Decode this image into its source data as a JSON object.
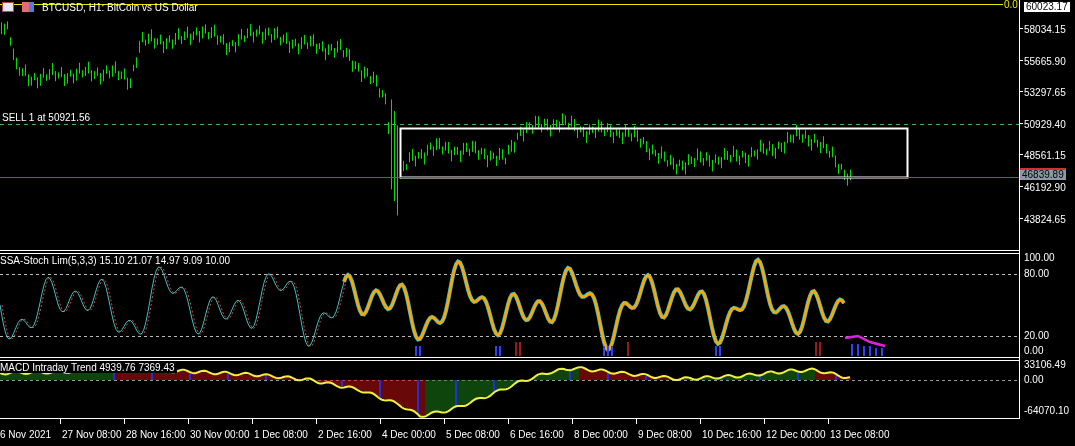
{
  "window": {
    "title": "BTCUSD, H1:  BitCoin vs US Dollar"
  },
  "main_pane": {
    "fibo_label": "0.0",
    "order_label": "SELL 1 at 50921.56",
    "current_price": "46839.89",
    "price_axis": [
      "60023.17",
      "58034.15",
      "55665.90",
      "53297.65",
      "50929.40",
      "48561.15",
      "46192.90",
      "43824.65"
    ]
  },
  "stoch_pane": {
    "label": "SSA-Stoch Lim(5,3,3) 15.10 21.07 14.97 9.09 10.00",
    "axis": [
      "100.00",
      "80.00",
      "20.00",
      "0.00"
    ]
  },
  "macd_pane": {
    "label": "MACD Intraday Trend  4939.76 7369.43",
    "axis": [
      "33106.49",
      "0.00",
      "-64070.10"
    ]
  },
  "time_axis": [
    "6 Nov 2021",
    "27 Nov 08:00",
    "28 Nov 16:00",
    "30 Nov 00:00",
    "1 Dec 08:00",
    "2 Dec 16:00",
    "4 Dec 00:00",
    "5 Dec 08:00",
    "6 Dec 16:00",
    "8 Dec 00:00",
    "9 Dec 08:00",
    "10 Dec 16:00",
    "12 Dec 00:00",
    "13 Dec 08:00"
  ]
}
